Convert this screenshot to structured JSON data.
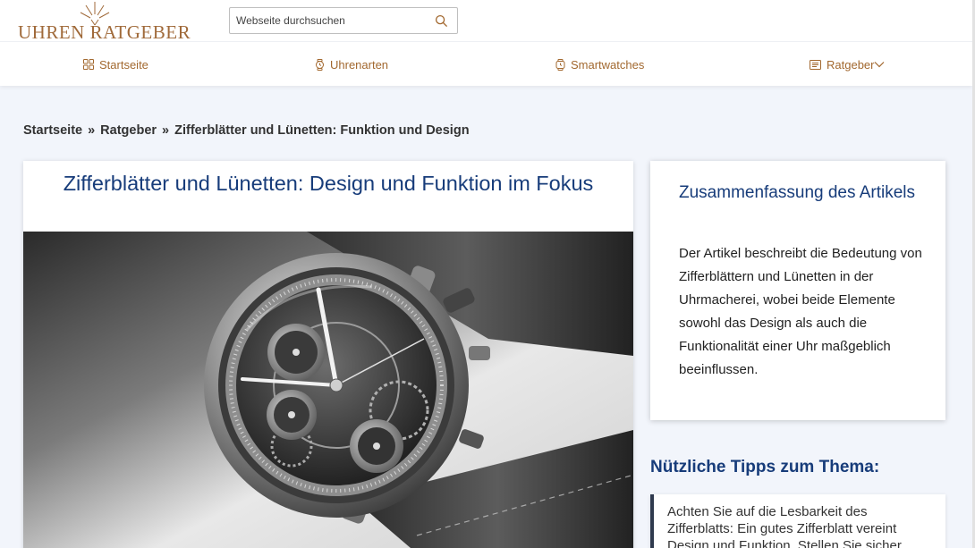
{
  "header": {
    "logo_text": "UHREN RATGEBER",
    "search_placeholder": "Webseite durchsuchen"
  },
  "nav": {
    "items": [
      {
        "label": "Startseite",
        "icon": "grid-icon"
      },
      {
        "label": "Uhrenarten",
        "icon": "watch-icon"
      },
      {
        "label": "Smartwatches",
        "icon": "smartwatch-icon"
      },
      {
        "label": "Ratgeber",
        "icon": "list-icon",
        "has_dropdown": true
      }
    ]
  },
  "breadcrumb": {
    "items": [
      "Startseite",
      "Ratgeber",
      "Zifferblätter und Lünetten: Funktion und Design"
    ],
    "separator": "»"
  },
  "article": {
    "title": "Zifferblätter und Lünetten: Design und Funktion im Fokus",
    "hero_image": "chronograph-watch-illustration"
  },
  "summary": {
    "title": "Zusammenfassung des Artikels",
    "text": "Der Artikel beschreibt die Bedeutung von Zifferblättern und Lünetten in der Uhrmacherei, wobei beide Elemente sowohl das Design als auch die Funktionalität einer Uhr maßgeblich beeinflussen."
  },
  "tips": {
    "title": "Nützliche Tipps zum Thema:",
    "items": [
      "Achten Sie auf die Lesbarkeit des Zifferblatts: Ein gutes Zifferblatt vereint Design und Funktion. Stellen Sie sicher,"
    ]
  },
  "colors": {
    "accent": "#a2682f",
    "title_blue": "#173c7a",
    "background": "#f2f5fb"
  }
}
